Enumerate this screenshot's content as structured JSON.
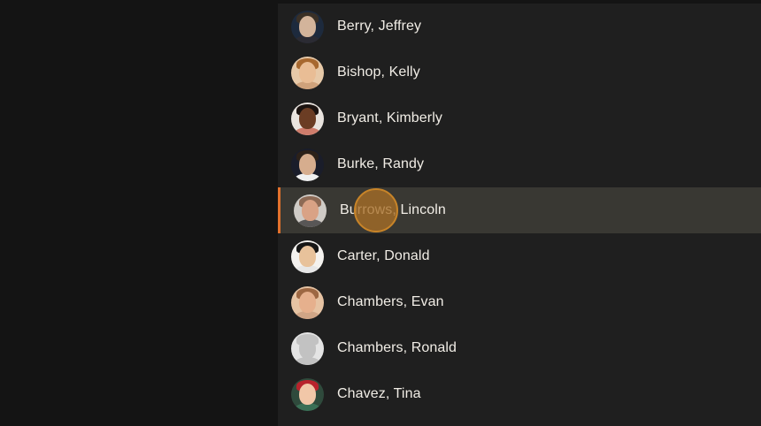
{
  "contacts": [
    {
      "name": "Berry, Jeffrey",
      "avatar": "person-avatar-icon",
      "bg": "#1d2a3d",
      "skin": "#d3b49b",
      "hair": "#3a3026",
      "shirt": "#2b2b33",
      "selected": false
    },
    {
      "name": "Bishop, Kelly",
      "avatar": "person-avatar-icon",
      "bg": "#e7c9a8",
      "skin": "#e9bd95",
      "hair": "#a7682f",
      "shirt": "#cfa27b",
      "selected": false
    },
    {
      "name": "Bryant, Kimberly",
      "avatar": "person-avatar-icon",
      "bg": "#e9e4df",
      "skin": "#6b3d24",
      "hair": "#1b1310",
      "shirt": "#cf7d6c",
      "selected": false
    },
    {
      "name": "Burke, Randy",
      "avatar": "person-avatar-icon",
      "bg": "#1a1d2a",
      "skin": "#d6ad8e",
      "hair": "#2c2119",
      "shirt": "#f0f0f0",
      "selected": false
    },
    {
      "name": "Burrows, Lincoln",
      "avatar": "person-avatar-icon",
      "bg": "#cfcbc6",
      "skin": "#d9a285",
      "hair": "#8d6a55",
      "shirt": "#585656",
      "selected": true
    },
    {
      "name": "Carter, Donald",
      "avatar": "person-avatar-icon",
      "bg": "#f4f2ef",
      "skin": "#e8c29b",
      "hair": "#161616",
      "shirt": "#e7e7e7",
      "selected": false
    },
    {
      "name": "Chambers, Evan",
      "avatar": "person-avatar-icon",
      "bg": "#e6c3a3",
      "skin": "#e6b08d",
      "hair": "#9d6742",
      "shirt": "#d0a586",
      "selected": false
    },
    {
      "name": "Chambers, Ronald",
      "avatar": "person-placeholder-icon",
      "bg": "#e4e4e4",
      "skin": "#c2c2c2",
      "hair": "#c2c2c2",
      "shirt": "#c2c2c2",
      "selected": false
    },
    {
      "name": "Chavez, Tina",
      "avatar": "person-avatar-icon",
      "bg": "#2f4a3c",
      "skin": "#f1c7a8",
      "hair": "#b8232c",
      "shirt": "#3a6f56",
      "selected": false
    }
  ],
  "colors": {
    "accent": "#e2712c",
    "selected_bg": "#393833",
    "list_bg": "#1f1f1f",
    "text": "#f1ede6",
    "touch_indicator": "#a86e26"
  }
}
